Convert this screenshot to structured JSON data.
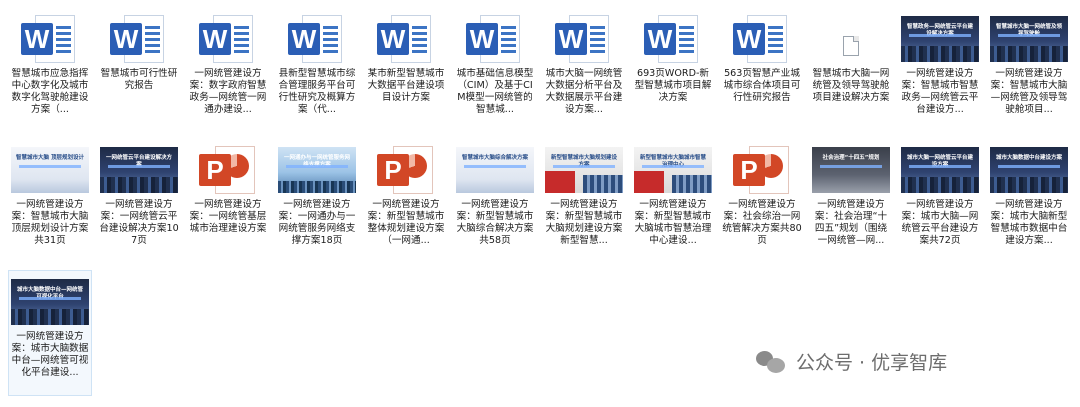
{
  "files": [
    {
      "type": "word",
      "label": "智慧城市应急指挥中心数字化及城市数字化驾驶舱建设方案（..."
    },
    {
      "type": "word",
      "label": "智慧城市可行性研究报告"
    },
    {
      "type": "word",
      "label": "一网统管建设方案：数字政府智慧政务—网统管一网通办建设..."
    },
    {
      "type": "word",
      "label": "县新型智慧城市综合管理服务平台可行性研究及概算方案（代..."
    },
    {
      "type": "word",
      "label": "某市新型智慧城市大数据平台建设项目设计方案"
    },
    {
      "type": "word",
      "label": "城市基础信息模型（CIM）及基于CIM模型一网统管的智慧城..."
    },
    {
      "type": "word",
      "label": "城市大脑一网统管大数据分析平台及大数据展示平台建设方案..."
    },
    {
      "type": "word",
      "label": "693页WORD-新型智慧城市项目解决方案"
    },
    {
      "type": "word",
      "label": "563页智慧产业城城市综合体项目可行性研究报告"
    },
    {
      "type": "blank",
      "label": "智慧城市大脑一网统管及领导驾驶舱项目建设解决方案"
    },
    {
      "type": "image",
      "style": "dark",
      "caption": "智慧政务—网统管云平台建设解决方案",
      "label": "一网统管建设方案：智慧城市智慧政务—网统管云平台建设方..."
    },
    {
      "type": "image",
      "style": "dark",
      "caption": "智慧城市大脑一网统管及领导驾驶舱",
      "label": "一网统管建设方案：智慧城市大脑—网统管及领导驾驶舱项目..."
    },
    {
      "type": "image",
      "style": "light",
      "caption": "智慧城市大脑 顶层规划设计",
      "label": "一网统管建设方案：智慧城市大脑顶层规划设计方案共31页"
    },
    {
      "type": "image",
      "style": "dark",
      "caption": "一网统管云平台建设解决方案",
      "label": "一网统管建设方案：一网统管云平台建设解决方案107页"
    },
    {
      "type": "ppt",
      "label": "一网统管建设方案：一网统管基层城市治理建设方案"
    },
    {
      "type": "image",
      "style": "sky",
      "caption": "一网通办与一网统管服务网络支撑方案",
      "label": "一网统管建设方案：一网通办与一网统管服务网络支撑方案18页"
    },
    {
      "type": "ppt",
      "label": "一网统管建设方案：新型智慧城市整体规划建设方案（一网通..."
    },
    {
      "type": "image",
      "style": "light",
      "caption": "智慧城市大脑综合解决方案",
      "label": "一网统管建设方案：新型智慧城市大脑综合解决方案共58页"
    },
    {
      "type": "image",
      "style": "red",
      "caption": "新型智慧城市大脑规划建设方案",
      "label": "一网统管建设方案：新型智慧城市大脑规划建设方案新型智慧..."
    },
    {
      "type": "image",
      "style": "red",
      "caption": "新型智慧城市大脑城市智慧治理中心",
      "label": "一网统管建设方案：新型智慧城市大脑城市智慧治理中心建设..."
    },
    {
      "type": "ppt",
      "label": "一网统管建设方案：社会综治一网统管解决方案共80页"
    },
    {
      "type": "image",
      "style": "gray",
      "caption": "社会治理“十四五”规划",
      "label": "一网统管建设方案：社会治理“十四五”规划（围绕一网统管—网..."
    },
    {
      "type": "image",
      "style": "dark",
      "caption": "城市大脑一网统管云平台建设方案",
      "label": "一网统管建设方案：城市大脑—网统管云平台建设方案共72页"
    },
    {
      "type": "image",
      "style": "dark",
      "caption": "城市大脑数据中台建设方案",
      "label": "一网统管建设方案：城市大脑新型智慧城市数据中台建设方案..."
    },
    {
      "type": "image",
      "style": "dark",
      "caption": "城市大脑数据中台—网统管可视化平台",
      "label": "一网统管建设方案：城市大脑数据中台—网统管可视化平台建设...",
      "selected": true
    }
  ],
  "watermark": {
    "text": "公众号 · 优享智库",
    "icon": "wechat-icon"
  },
  "colors": {
    "word": "#2b5eb5",
    "ppt": "#d24726",
    "selection": "#cfe3f5"
  }
}
